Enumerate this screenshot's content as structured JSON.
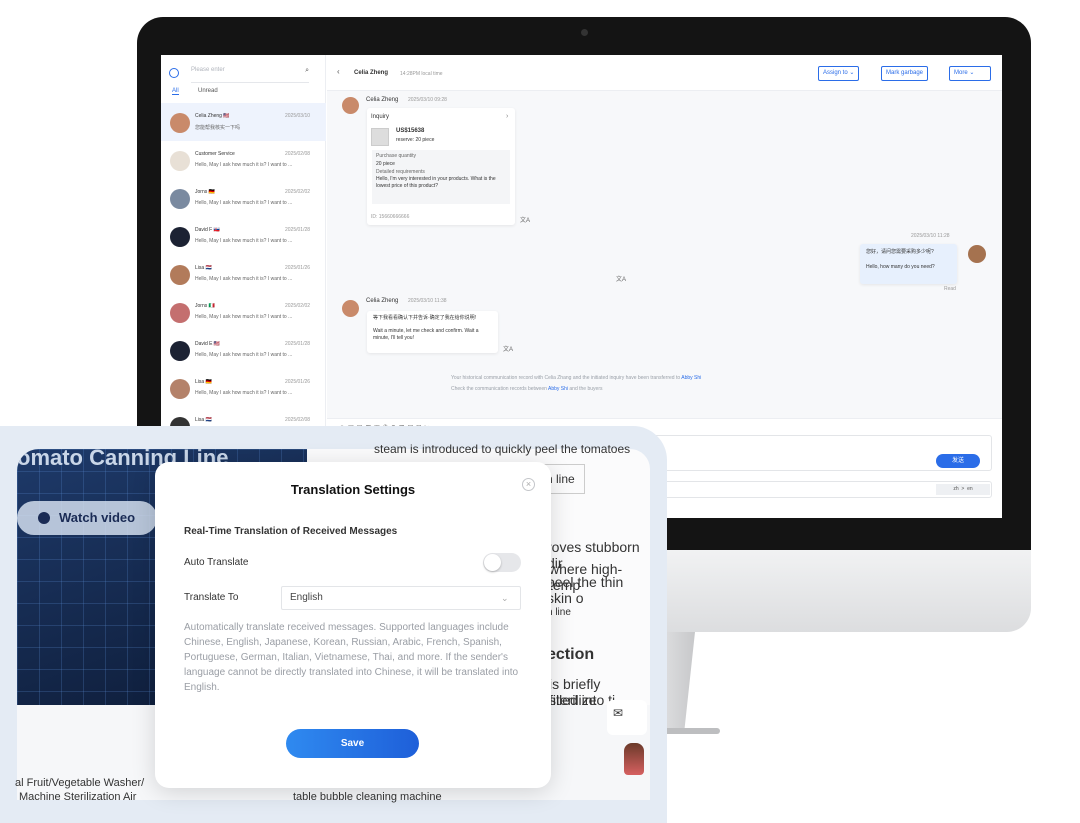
{
  "chat": {
    "search_placeholder": "Please enter",
    "tabs": [
      "All",
      "Unread"
    ],
    "list": [
      {
        "name": "Celia Zheng 🇺🇸",
        "date": "2025/03/10",
        "preview": "您能帮我核实一下吗"
      },
      {
        "name": "Customer Service",
        "date": "2025/02/08",
        "preview": "Hello, May I ask how much it is? I want to ..."
      },
      {
        "name": "Jorns 🇩🇪",
        "date": "2025/02/02",
        "preview": "Hello, May I ask how much it is? I want to ..."
      },
      {
        "name": "David F 🇸🇰",
        "date": "2025/01/28",
        "preview": "Hello, May I ask how much it is? I want to ..."
      },
      {
        "name": "Lisa 🇳🇱",
        "date": "2025/01/26",
        "preview": "Hello, May I ask how much it is? I want to ..."
      },
      {
        "name": "Jorns 🇮🇹",
        "date": "2025/02/02",
        "preview": "Hello, May I ask how much it is? I want to ..."
      },
      {
        "name": "David E 🇺🇸",
        "date": "2025/01/28",
        "preview": "Hello, May I ask how much it is? I want to ..."
      },
      {
        "name": "Lisa 🇩🇪",
        "date": "2025/01/26",
        "preview": "Hello, May I ask how much it is? I want to ..."
      },
      {
        "name": "Lisa 🇳🇱",
        "date": "2025/02/08",
        "preview": ""
      }
    ],
    "header": {
      "contact": "Celia Zheng",
      "local_time": "14:28PM local time",
      "assign": "Assign to",
      "garbage": "Mark garbage",
      "more": "More"
    },
    "msg1": {
      "name": "Celia Zheng",
      "time": "2025/03/10 09:28",
      "card_title": "Inquiry",
      "price": "US$15638",
      "reserve": "reserve:  20 piece",
      "qty_label": "Purchase quantity",
      "qty": "20 piece",
      "req_label": "Detailed requirements",
      "req": "Hello, I'm very interested in your products. What is the lowest price of this product?",
      "id": "ID:  15660666666"
    },
    "msg2": {
      "time": "2025/03/10 11:28",
      "line1": "您好，请问您需要采购多少呢?",
      "line2": "Hello, how many do you need?",
      "status": "Read"
    },
    "msg3": {
      "name": "Celia Zheng",
      "time": "2025/03/10 11:38",
      "line1": "等下我看看确认下并告诉·确定了我在给你说明!",
      "line2": "Wait a minute, let me check and confirm. Wait a minute, I'll tell you!"
    },
    "note": {
      "a": "Your historical communication record with Celia Zhang and the initiated inquiry have been transferred to ",
      "abby1": "Abby Shi",
      "b": "Check the communication records between ",
      "abby2": "Abby Shi",
      "c": " and the buyers"
    },
    "send": "发送",
    "lang_from": "zh",
    "lang_arrow": ">",
    "lang_to": "en"
  },
  "website": {
    "heading": "omato Canning Line",
    "watch": "Watch video",
    "t1": "roves stubborn dir",
    "t2": "where high-temp",
    "t3": "peel the thin skin o",
    "link1": "n line",
    "link2": "n line",
    "t4": "ection",
    "t5": "is briefly sterilize",
    "t6": "filled into ti",
    "left1": "al Fruit/Vegetable Washer/",
    "left2": "Machine Sterilization Air",
    "bottom": "table bubble cleaning machine",
    "intro": "steam is introduced to quickly peel the tomatoes"
  },
  "dialog": {
    "title": "Translation Settings",
    "close": "×",
    "section": "Real-Time Translation of Received Messages",
    "auto_label": "Auto Translate",
    "auto_on": false,
    "to_label": "Translate To",
    "to_value": "English",
    "chevron": "⌄",
    "desc": "Automatically translate received messages. Supported languages include Chinese, English, Japanese, Korean, Russian, Arabic, French, Spanish, Portuguese, German, Italian, Vietnamese, Thai, and more. If the sender's language cannot be directly translated into Chinese, it will be translated into English.",
    "save": "Save"
  },
  "colors": {
    "accent": "#2b6de8",
    "save_start": "#2f8af0",
    "save_end": "#1e5fd9"
  }
}
